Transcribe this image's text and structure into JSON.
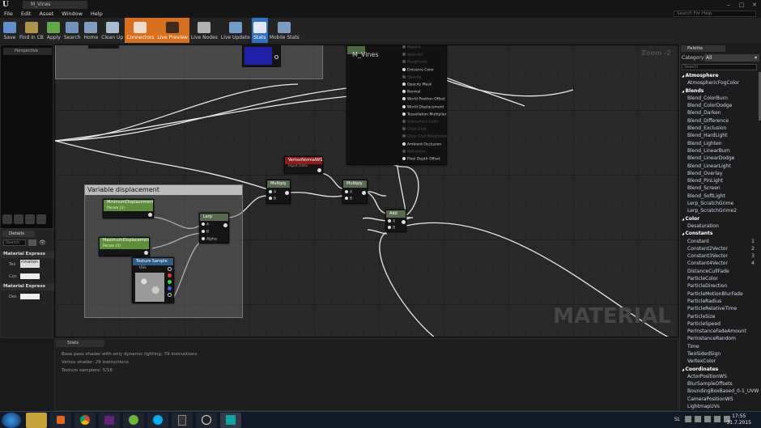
{
  "window": {
    "tab_title": "M_Vines",
    "search_help_placeholder": "Search For Help"
  },
  "menu": [
    "File",
    "Edit",
    "Asset",
    "Window",
    "Help"
  ],
  "toolbar": [
    {
      "label": "Save",
      "icon": "save-icon",
      "state": "normal"
    },
    {
      "label": "Find in CB",
      "icon": "find-in-cb-icon",
      "state": "normal"
    },
    {
      "label": "Apply",
      "icon": "apply-icon",
      "state": "normal"
    },
    {
      "label": "Search",
      "icon": "search-icon",
      "state": "normal"
    },
    {
      "label": "Home",
      "icon": "home-icon",
      "state": "normal"
    },
    {
      "label": "Clean Up",
      "icon": "clean-up-icon",
      "state": "normal"
    },
    {
      "label": "Connectors",
      "icon": "connectors-icon",
      "state": "active"
    },
    {
      "label": "Live Preview",
      "icon": "live-preview-icon",
      "state": "active"
    },
    {
      "label": "Live Nodes",
      "icon": "live-nodes-icon",
      "state": "normal"
    },
    {
      "label": "Live Update",
      "icon": "live-update-icon",
      "state": "normal"
    },
    {
      "label": "Stats",
      "icon": "stats-icon",
      "state": "active-blue"
    },
    {
      "label": "Mobile Stats",
      "icon": "mobile-stats-icon",
      "state": "normal"
    }
  ],
  "preview": {
    "viewport_label": "Perspective"
  },
  "details": {
    "tab": "Details",
    "search_placeholder": "Search",
    "section1": "Material Express",
    "tex_label": "Tex",
    "tex_value": "rimation",
    "con_label": "Con",
    "section2": "Material Express",
    "des_label": "Des"
  },
  "graph": {
    "zoom": "Zoom -2",
    "watermark": "MATERIAL",
    "comment_title": "Variable displacement",
    "material_node": {
      "title": "M_Vines",
      "pins": [
        {
          "label": "Metallic",
          "enabled": false
        },
        {
          "label": "Specular",
          "enabled": false
        },
        {
          "label": "Roughness",
          "enabled": false
        },
        {
          "label": "Emissive Color",
          "enabled": true
        },
        {
          "label": "Opacity",
          "enabled": false
        },
        {
          "label": "Opacity Mask",
          "enabled": true
        },
        {
          "label": "Normal",
          "enabled": true
        },
        {
          "label": "World Position Offset",
          "enabled": true
        },
        {
          "label": "World Displacement",
          "enabled": true
        },
        {
          "label": "Tessellation Multiplier",
          "enabled": true
        },
        {
          "label": "Subsurface Color",
          "enabled": false
        },
        {
          "label": "Clear Coat",
          "enabled": false
        },
        {
          "label": "Clear Coat Roughness",
          "enabled": false
        },
        {
          "label": "Ambient Occlusion",
          "enabled": true
        },
        {
          "label": "Refraction",
          "enabled": false
        },
        {
          "label": "Pixel Depth Offset",
          "enabled": true
        }
      ]
    },
    "vertex_normal": {
      "title": "VertexNormalWS",
      "sub": "Input Data"
    },
    "multiply1": {
      "title": "Multiply",
      "pin_a": "A",
      "pin_b": "B"
    },
    "multiply2": {
      "title": "Multiply",
      "pin_a": "A",
      "pin_b": "B"
    },
    "add": {
      "title": "Add",
      "pin_a": "A",
      "pin_b": "B"
    },
    "lerp": {
      "title": "Lerp",
      "pin_a": "A",
      "pin_b": "B",
      "pin_alpha": "Alpha"
    },
    "min_disp": {
      "title": "MinimumDisplacement",
      "sub": "Param (1)"
    },
    "max_disp": {
      "title": "MaximumDisplacement",
      "sub": "Param (5)"
    },
    "tex_sample": {
      "title": "Texture Sample",
      "uvs": "UVs"
    }
  },
  "palette": {
    "tab": "Palette",
    "category_label": "Category",
    "category_value": "All",
    "search_placeholder": "Search",
    "items": [
      {
        "label": "Atmosphere",
        "cat": true
      },
      {
        "label": "AtmosphericFogColor"
      },
      {
        "label": "Blends",
        "cat": true
      },
      {
        "label": "Blend_ColorBurn"
      },
      {
        "label": "Blend_ColorDodge"
      },
      {
        "label": "Blend_Darken"
      },
      {
        "label": "Blend_Difference"
      },
      {
        "label": "Blend_Exclusion"
      },
      {
        "label": "Blend_HardLight"
      },
      {
        "label": "Blend_Lighten"
      },
      {
        "label": "Blend_LinearBurn"
      },
      {
        "label": "Blend_LinearDodge"
      },
      {
        "label": "Blend_LinearLight"
      },
      {
        "label": "Blend_Overlay"
      },
      {
        "label": "Blend_PinLight"
      },
      {
        "label": "Blend_Screen"
      },
      {
        "label": "Blend_SoftLight"
      },
      {
        "label": "Lerp_ScratchGrime"
      },
      {
        "label": "Lerp_ScratchGrime2"
      },
      {
        "label": "Color",
        "cat": true
      },
      {
        "label": "Desaturation"
      },
      {
        "label": "Constants",
        "cat": true
      },
      {
        "label": "Constant",
        "shortcut": "1"
      },
      {
        "label": "Constant2Vector",
        "shortcut": "2"
      },
      {
        "label": "Constant3Vector",
        "shortcut": "3"
      },
      {
        "label": "Constant4Vector",
        "shortcut": "4"
      },
      {
        "label": "DistanceCullFade"
      },
      {
        "label": "ParticleColor"
      },
      {
        "label": "ParticleDirection"
      },
      {
        "label": "ParticleMotionBlurFade"
      },
      {
        "label": "ParticleRadius"
      },
      {
        "label": "ParticleRelativeTime"
      },
      {
        "label": "ParticleSize"
      },
      {
        "label": "ParticleSpeed"
      },
      {
        "label": "PerInstanceFadeAmount"
      },
      {
        "label": "PerInstanceRandom"
      },
      {
        "label": "Time"
      },
      {
        "label": "TwoSidedSign"
      },
      {
        "label": "VertexColor"
      },
      {
        "label": "Coordinates",
        "cat": true
      },
      {
        "label": "ActorPositionWS"
      },
      {
        "label": "BlurSampleOffsets"
      },
      {
        "label": "BoundingBoxBased_0-1_UVW"
      },
      {
        "label": "CameraPositionWS"
      },
      {
        "label": "LightmapUVs"
      }
    ]
  },
  "stats": {
    "tab": "Stats",
    "lines": [
      "Base pass shader with only dynamic lighting: 79 instructions",
      "Vertex shader: 29 instructions",
      "Texture samplers: 5/16"
    ]
  },
  "taskbar": {
    "language": "SL",
    "time": "17:55",
    "date": "31.7.2015"
  }
}
